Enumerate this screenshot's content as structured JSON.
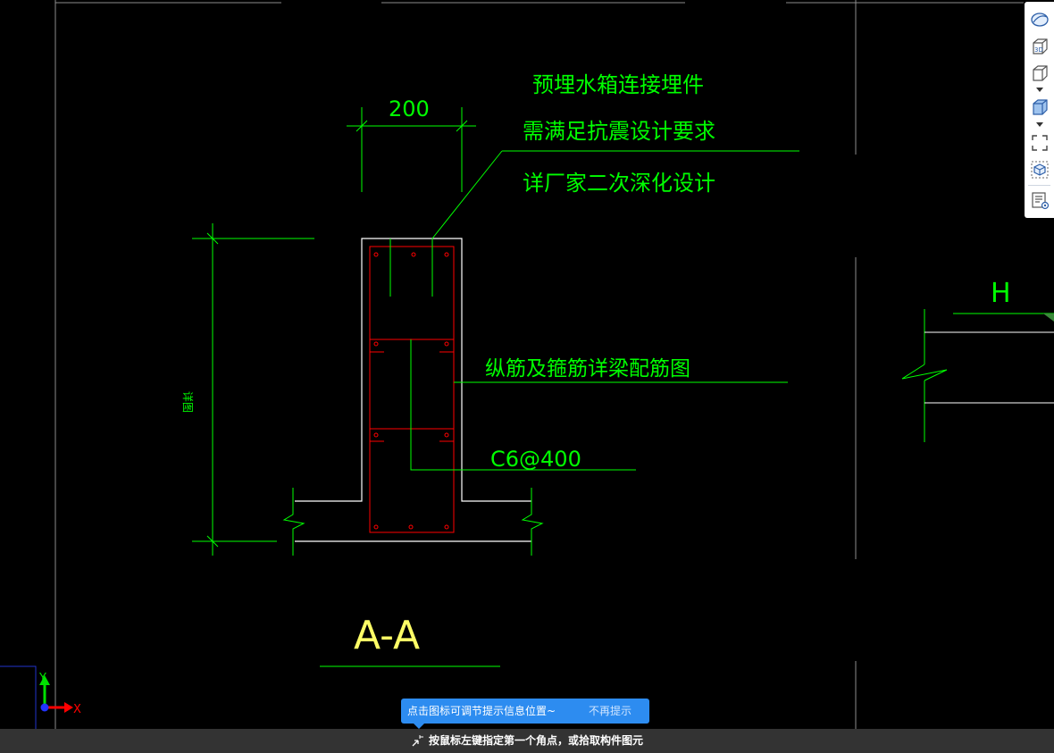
{
  "drawing": {
    "annotation": {
      "line1": "预埋水箱连接埋件",
      "line2": "需满足抗震设计要求",
      "line3": "详厂家二次深化设计"
    },
    "dim_width": "200",
    "dim_height": "详图",
    "rebar_note": "纵筋及箍筋详梁配筋图",
    "stirrup_note": "C6@400",
    "section_label": "A-A",
    "side_label": "H"
  },
  "ucs": {
    "y": "Y",
    "x": "X"
  },
  "colors": {
    "green": "#00ff00",
    "red": "#ff0000",
    "white": "#ffffff",
    "yellow": "#ffff66",
    "gray": "#8c8c8c"
  },
  "toolbar": {
    "items": [
      "orbit-icon",
      "3d-view-icon",
      "cube-wireframe-icon",
      "cube-shaded-icon",
      "fullscreen-icon",
      "component-icon",
      "properties-icon"
    ]
  },
  "tooltip": {
    "message": "点击图标可调节提示信息位置~",
    "dismiss": "不再提示"
  },
  "status": {
    "prompt": "按鼠标左键指定第一个角点，或拾取构件图元"
  }
}
